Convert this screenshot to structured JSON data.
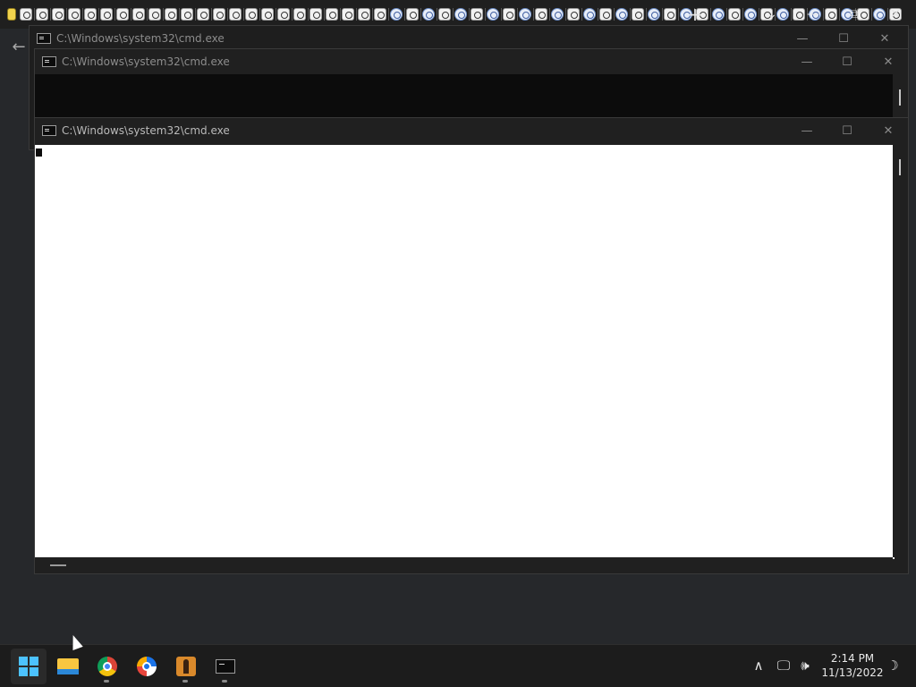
{
  "browser": {
    "tab_icon_count": 56,
    "new_tab_label": "+",
    "tab_list_label": "⌄",
    "back_label": "←",
    "controls": {
      "minimize": "—",
      "maximize": "⧉",
      "close": "✕"
    }
  },
  "windows": [
    {
      "title": "C:\\Windows\\system32\\cmd.exe"
    },
    {
      "title": "C:\\Windows\\system32\\cmd.exe"
    },
    {
      "title": "C:\\Windows\\system32\\cmd.exe",
      "console_background": "#ffffff"
    }
  ],
  "window_controls": {
    "minimize": "—",
    "maximize": "☐",
    "close": "✕"
  },
  "taskbar": {
    "apps": [
      "start-button",
      "file-explorer",
      "google-chrome",
      "brave-browser",
      "game-app",
      "command-prompt"
    ],
    "tray": {
      "overflow": "∧",
      "network": "🖵",
      "volume": "🕪",
      "notifications": "☽"
    },
    "time": "2:14 PM",
    "date": "11/13/2022"
  },
  "colors": {
    "accent": "#4cc2ff",
    "console_bg": "#0c0c0c",
    "taskbar_bg": "#1c1c1c"
  }
}
